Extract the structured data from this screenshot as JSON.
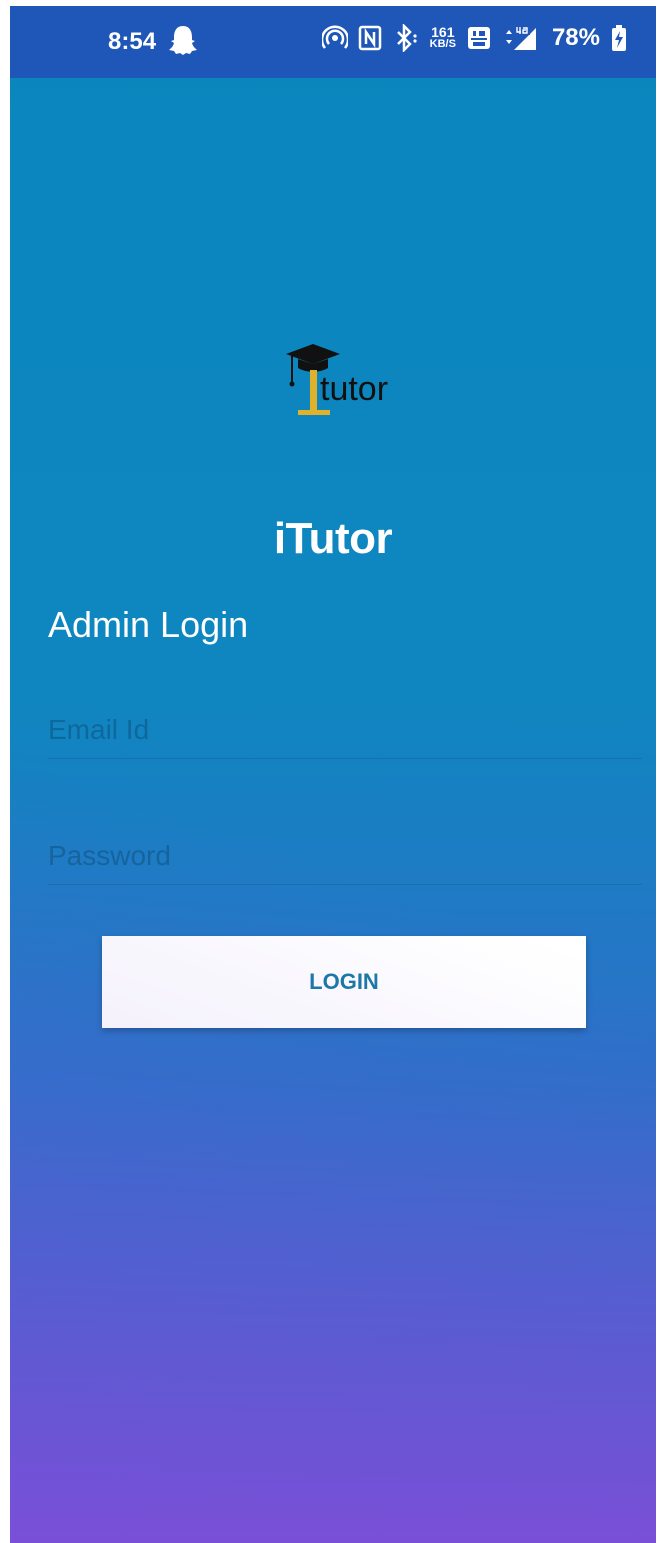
{
  "status_bar": {
    "time": "8:54",
    "net_speed_value": "161",
    "net_speed_unit": "KB/S",
    "battery_percent": "78%",
    "icons": [
      "snapchat-ghost-icon",
      "hotspot-icon",
      "nfc-icon",
      "bluetooth-icon",
      "volte-icon",
      "signal-4g-icon",
      "battery-charging-icon"
    ]
  },
  "logo": {
    "text": "tutor"
  },
  "app": {
    "name": "iTutor"
  },
  "login": {
    "heading": "Admin Login",
    "email_placeholder": "Email Id",
    "password_placeholder": "Password",
    "button_label": "LOGIN"
  },
  "colors": {
    "status_bar": "#1f57b8",
    "gradient_top": "#0a86bd",
    "gradient_bottom": "#7a4fd6",
    "button_text": "#1a7aa5",
    "logo_gold": "#e0b12a"
  }
}
